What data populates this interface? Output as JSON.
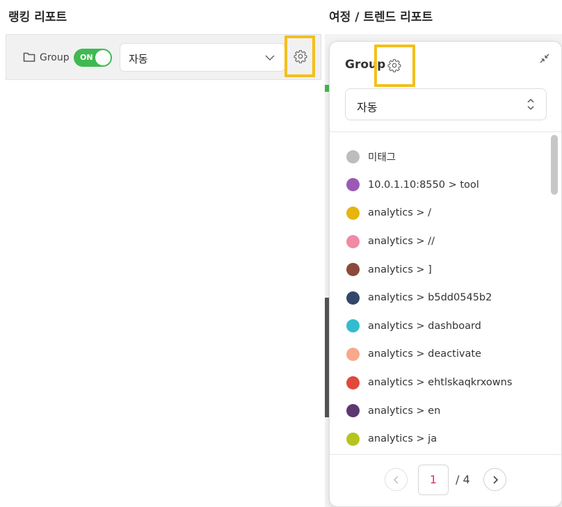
{
  "left_panel": {
    "heading": "랭킹 리포트",
    "group_label": "Group",
    "toggle_label": "ON",
    "select_value": "자동"
  },
  "right_panel": {
    "heading": "여정 / 트렌드 리포트",
    "popup": {
      "title": "Group",
      "select_value": "자동",
      "items": [
        {
          "label": "미태그",
          "color": "#bdbdbd"
        },
        {
          "label": "10.0.1.10:8550 > tool",
          "color": "#9b59b6"
        },
        {
          "label": "analytics > /",
          "color": "#e6b511"
        },
        {
          "label": "analytics > //",
          "color": "#f08aa5"
        },
        {
          "label": "analytics > ]",
          "color": "#8b4a3a"
        },
        {
          "label": "analytics > b5dd0545b2",
          "color": "#34466a"
        },
        {
          "label": "analytics > dashboard",
          "color": "#33bcd0"
        },
        {
          "label": "analytics > deactivate",
          "color": "#f8a98a"
        },
        {
          "label": "analytics > ehtlskaqkrxowns",
          "color": "#e2473b"
        },
        {
          "label": "analytics > en",
          "color": "#5c3770"
        },
        {
          "label": "analytics > ja",
          "color": "#b6c41f"
        }
      ],
      "pagination": {
        "current_page": "1",
        "total": "/ 4"
      }
    }
  },
  "colors": {
    "toggle_on": "#3fb950",
    "highlight": "#f3c01c",
    "current_page": "#e0315b"
  }
}
